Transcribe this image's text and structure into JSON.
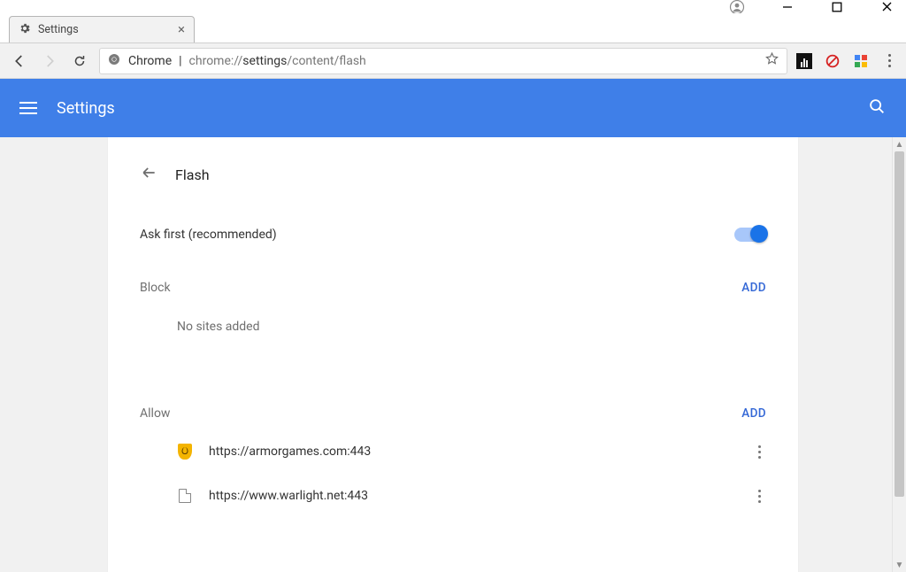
{
  "window": {
    "tab_title": "Settings",
    "omnibox_label": "Chrome",
    "url_prefix": "chrome://",
    "url_mid": "settings",
    "url_suffix": "/content/flash"
  },
  "app": {
    "title": "Settings"
  },
  "page": {
    "title": "Flash",
    "ask_first": "Ask first (recommended)"
  },
  "sections": {
    "block": {
      "label": "Block",
      "add": "ADD",
      "empty": "No sites added"
    },
    "allow": {
      "label": "Allow",
      "add": "ADD",
      "sites": [
        {
          "url": "https://armorgames.com:443",
          "icon": "shield"
        },
        {
          "url": "https://www.warlight.net:443",
          "icon": "file"
        }
      ]
    }
  }
}
